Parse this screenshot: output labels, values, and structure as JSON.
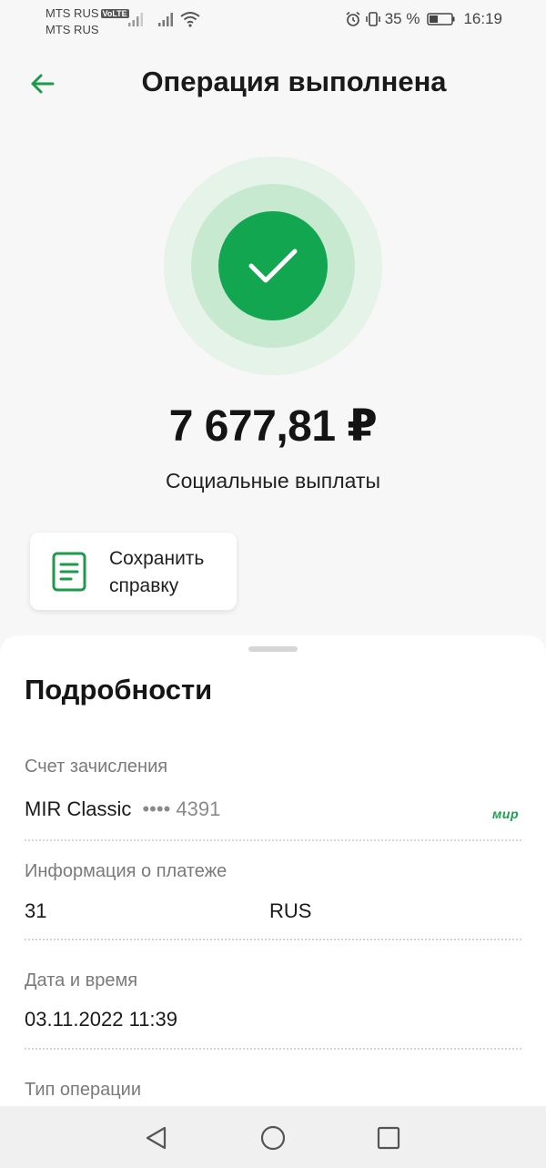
{
  "status_bar": {
    "carrier1": "MTS RUS",
    "volte": "VoLTE",
    "carrier2": "MTS RUS",
    "battery": "35 %",
    "time": "16:19"
  },
  "header": {
    "title": "Операция выполнена"
  },
  "operation": {
    "amount": "7 677,81 ₽",
    "category": "Социальные выплаты",
    "status_color": "#13a650"
  },
  "actions": {
    "save_certificate": "Сохранить справку"
  },
  "details": {
    "title": "Подробности",
    "account_label": "Счет зачисления",
    "account_name": "MIR Classic",
    "account_mask": "••••",
    "account_last4": "4391",
    "payment_system": "мир",
    "payment_info_label": "Информация о платеже",
    "payment_info_code": "31",
    "payment_info_country": "RUS",
    "datetime_label": "Дата и время",
    "datetime_value": "03.11.2022 11:39",
    "type_label": "Тип операции"
  },
  "icons": {
    "back": "arrow-left-icon",
    "success": "check-icon",
    "document": "document-icon",
    "nav_back": "triangle-back-icon",
    "nav_home": "circle-home-icon",
    "nav_recent": "square-recent-icon"
  },
  "colors": {
    "accent": "#13a650",
    "ring_inner": "#c6e9d0",
    "ring_outer": "#e5f3e8"
  }
}
